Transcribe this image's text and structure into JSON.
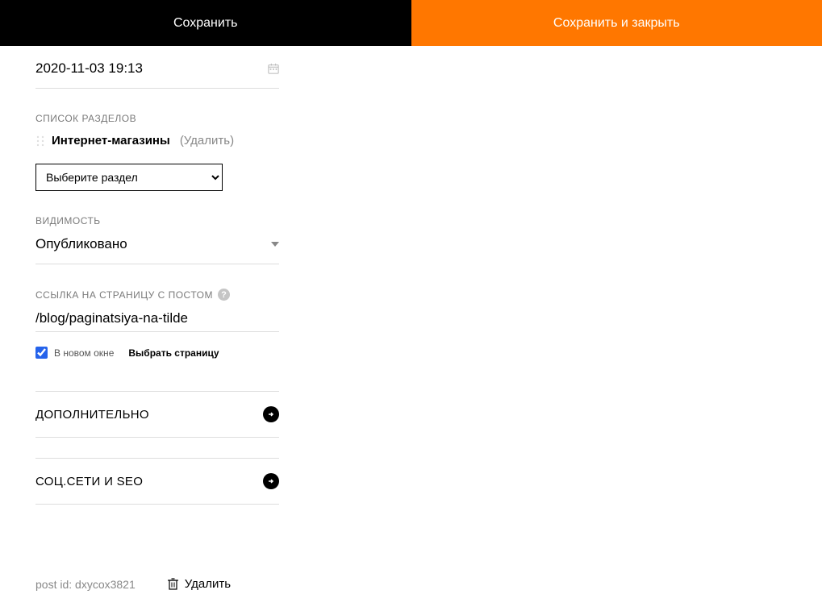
{
  "topbar": {
    "save": "Сохранить",
    "save_close": "Сохранить и закрыть"
  },
  "date": {
    "value": "2020-11-03 19:13"
  },
  "sections": {
    "label": "СПИСОК РАЗДЕЛОВ",
    "item_name": "Интернет-магазины",
    "remove": "(Удалить)",
    "select_placeholder": "Выберите раздел"
  },
  "visibility": {
    "label": "ВИДИМОСТЬ",
    "value": "Опубликовано"
  },
  "link": {
    "label": "ССЫЛКА НА СТРАНИЦУ С ПОСТОМ",
    "value": "/blog/paginatsiya-na-tilde",
    "new_window": "В новом окне",
    "select_page": "Выбрать страницу"
  },
  "collapsible": {
    "additional": "ДОПОЛНИТЕЛЬНО",
    "social": "СОЦ.СЕТИ И SEO"
  },
  "footer": {
    "post_id": "post id: dxycox3821",
    "delete": "Удалить"
  }
}
